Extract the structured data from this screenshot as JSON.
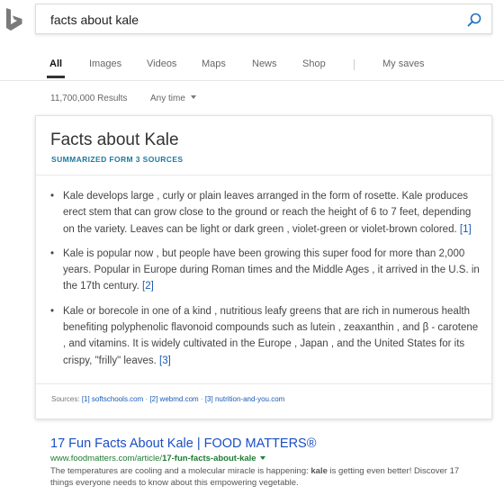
{
  "search": {
    "query": "facts about kale"
  },
  "nav": {
    "items": [
      "All",
      "Images",
      "Videos",
      "Maps",
      "News",
      "Shop",
      "My saves"
    ],
    "active": "All"
  },
  "filters": {
    "results_count": "11,700,000 Results",
    "time_filter": "Any time"
  },
  "answer": {
    "title": "Facts about Kale",
    "subtitle": "SUMMARIZED FORM 3 SOURCES",
    "facts": [
      {
        "text": "Kale develops large , curly or plain leaves arranged in the form of rosette. Kale produces erect stem that can grow close to the ground or reach the height of 6 to 7 feet, depending on the variety. Leaves can be light or dark green , violet-green or violet-brown colored.",
        "cite": "[1]"
      },
      {
        "text": "Kale is popular now , but people have been growing this super food for more than 2,000 years. Popular in Europe during Roman times and the Middle Ages , it arrived in the U.S. in the 17th century.",
        "cite": "[2]"
      },
      {
        "text": "Kale or borecole in one of a kind , nutritious leafy greens that are rich in numerous health benefiting polyphenolic flavonoid compounds such as lutein , zeaxanthin , and β - carotene , and vitamins. It is widely cultivated in the Europe , Japan , and the United States for its crispy, \"frilly\" leaves.",
        "cite": "[3]"
      }
    ],
    "sources": {
      "label": "Sources:",
      "links": [
        "[1] softschools.com",
        "[2] webmd.com",
        "[3] nutrition-and-you.com"
      ],
      "separator": "·"
    }
  },
  "result": {
    "title": "17 Fun Facts About Kale | FOOD MATTERS®",
    "url_prefix": "www.foodmatters.com/article/",
    "url_bold": "17-fun-facts-about-kale",
    "snippet_before": "The temperatures are cooling and a molecular miracle is happening: ",
    "snippet_bold": "kale",
    "snippet_after": " is getting even better! Discover 17 things everyone needs to know about this empowering vegetable."
  },
  "icons": {
    "logo": "bing-logo",
    "search": "search-icon"
  },
  "colors": {
    "link": "#1a4fc4",
    "url_green": "#1e7b32",
    "subtitle_teal": "#1b7aa0"
  }
}
